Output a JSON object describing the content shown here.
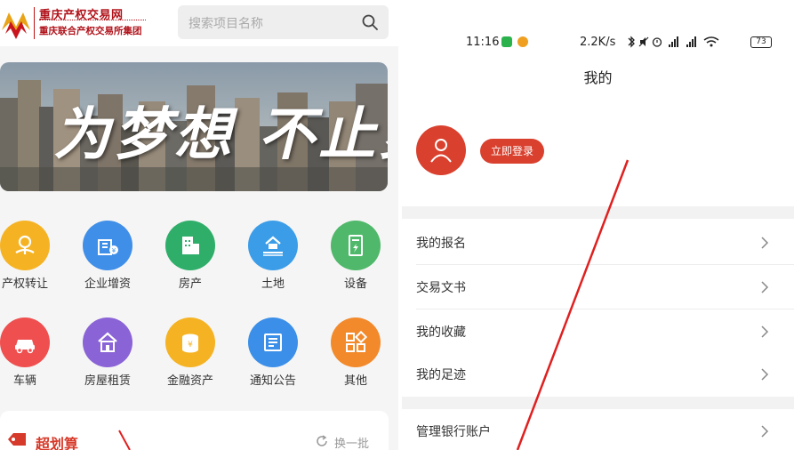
{
  "left": {
    "logo": {
      "name": "重庆产权交易网",
      "subtitle": "重庆联合产权交易所集团"
    },
    "search": {
      "placeholder": "搜索项目名称"
    },
    "banner": {
      "slogan": "为梦想 不止步"
    },
    "categories": [
      {
        "label": "产权转让",
        "color": "#f5b324",
        "icon": "property-transfer-icon"
      },
      {
        "label": "企业增资",
        "color": "#3f8ee8",
        "icon": "capital-increase-icon"
      },
      {
        "label": "房产",
        "color": "#2fae6a",
        "icon": "building-icon"
      },
      {
        "label": "土地",
        "color": "#3b9de8",
        "icon": "land-icon"
      },
      {
        "label": "设备",
        "color": "#4fb86a",
        "icon": "equipment-icon"
      },
      {
        "label": "车辆",
        "color": "#ef4f4f",
        "icon": "car-icon"
      },
      {
        "label": "房屋租赁",
        "color": "#8a63d6",
        "icon": "house-rental-icon"
      },
      {
        "label": "金融资产",
        "color": "#f5b324",
        "icon": "financial-asset-icon"
      },
      {
        "label": "通知公告",
        "color": "#3b8fe8",
        "icon": "notice-icon"
      },
      {
        "label": "其他",
        "color": "#f28a2c",
        "icon": "other-icon"
      }
    ],
    "deals": {
      "title": "超划算",
      "refresh_label": "换一批"
    }
  },
  "right": {
    "status_bar": {
      "time": "11:16",
      "speed": "2.2K/s",
      "battery": "73"
    },
    "title": "我的",
    "login_label": "立即登录",
    "menu": [
      {
        "label": "我的报名"
      },
      {
        "label": "交易文书"
      },
      {
        "label": "我的收藏"
      },
      {
        "label": "我的足迹"
      },
      {
        "label": "管理银行账户"
      }
    ]
  },
  "colors": {
    "brand_red": "#d9402e",
    "logo_red": "#b0121a"
  }
}
